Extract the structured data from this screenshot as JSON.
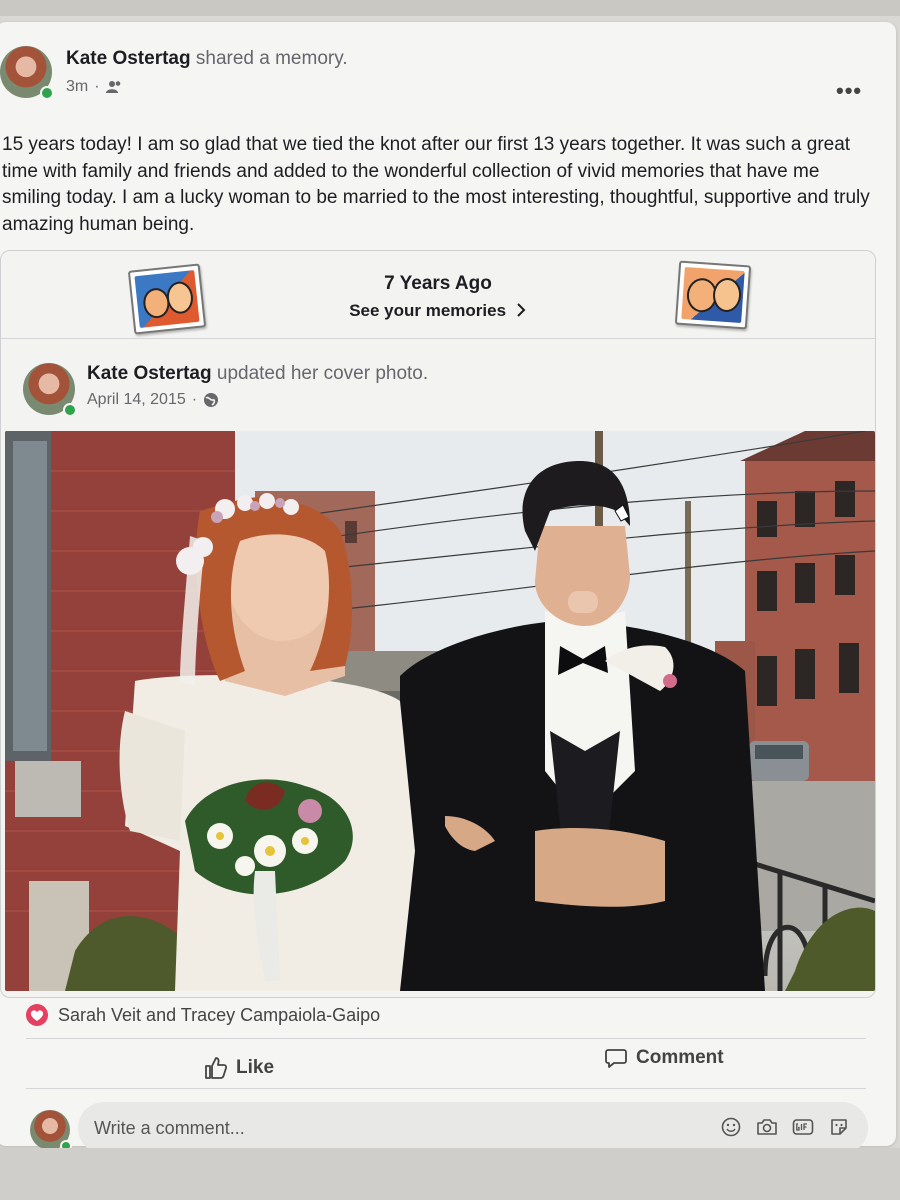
{
  "post": {
    "author": "Kate Ostertag",
    "action": "shared a memory.",
    "time": "3m",
    "text": "15 years today! I am so glad that we tied the knot after our first 13 years together. It was such a great time with family and friends and added to the wonderful collection of vivid memories that have me smiling today. I am a lucky woman to be married to the most interesting, thoughtful, supportive and truly amazing human being."
  },
  "memories": {
    "title": "7 Years Ago",
    "link": "See your memories"
  },
  "shared_post": {
    "author": "Kate Ostertag",
    "action": "updated her cover photo.",
    "date": "April 14, 2015"
  },
  "reactions": {
    "names": "Sarah Veit and Tracey Campaiola-Gaipo"
  },
  "actions": {
    "like": "Like",
    "comment": "Comment"
  },
  "comment_box": {
    "placeholder": "Write a comment..."
  },
  "colors": {
    "online": "#31a24c",
    "love": "#e4405f"
  }
}
